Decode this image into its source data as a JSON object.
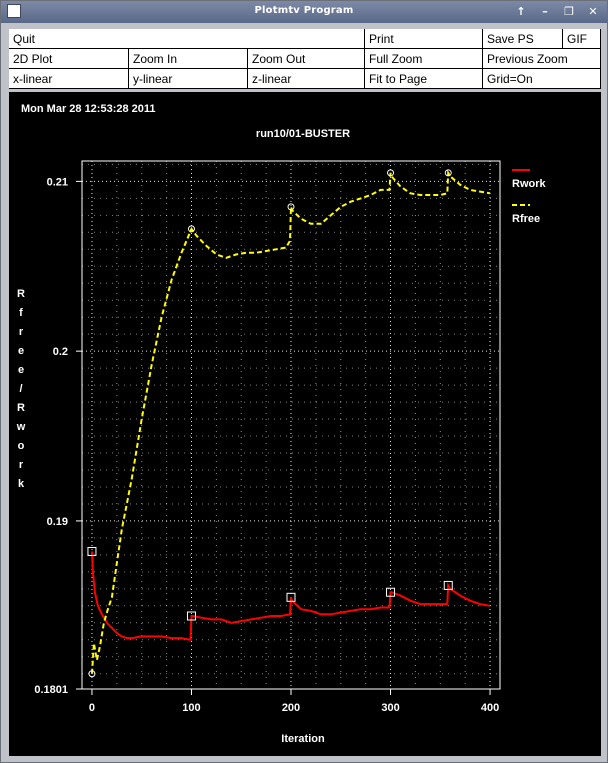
{
  "window": {
    "title": "Plotmtv Program",
    "buttons": [
      "↑",
      "–",
      "❐",
      "✕"
    ]
  },
  "menu": {
    "rows": [
      [
        "Quit",
        "Print",
        "Save PS",
        "GIF"
      ],
      [
        "2D Plot",
        "Zoom In",
        "Zoom Out",
        "Full Zoom",
        "Previous Zoom"
      ],
      [
        "x-linear",
        "y-linear",
        "z-linear",
        "Fit to Page",
        "Grid=On"
      ]
    ]
  },
  "plot": {
    "timestamp": "Mon Mar 28 12:53:28 2011"
  },
  "chart_data": {
    "type": "line",
    "title": "run10/01-BUSTER",
    "xlabel": "Iteration",
    "ylabel": "Rfree / Rwork",
    "xlim": [
      -10,
      410
    ],
    "ylim": [
      0.1801,
      0.2112
    ],
    "xticks": [
      0,
      100,
      200,
      300,
      400
    ],
    "yticks": [
      0.1801,
      0.19,
      0.2,
      0.21
    ],
    "ytick_labels": [
      "0.1801",
      "0.19",
      "0.2",
      "0.21"
    ],
    "grid": true,
    "legend_position": "right",
    "colors": {
      "Rwork": "#ff0000",
      "Rfree": "#ffff00",
      "axes": "#ffffff",
      "grid": "#ffffff"
    },
    "series": [
      {
        "name": "Rwork",
        "style": "solid",
        "marker": "square",
        "marker_x": [
          0,
          100,
          200,
          300,
          358
        ],
        "x": [
          0,
          1,
          3,
          6,
          10,
          15,
          20,
          25,
          30,
          35,
          40,
          50,
          60,
          70,
          80,
          90,
          99,
          100,
          101,
          110,
          120,
          130,
          140,
          150,
          160,
          170,
          180,
          190,
          199,
          200,
          201,
          210,
          220,
          230,
          240,
          250,
          260,
          270,
          280,
          290,
          299,
          300,
          301,
          310,
          320,
          330,
          340,
          350,
          357,
          358,
          360,
          370,
          380,
          390,
          400
        ],
        "values": [
          0.1882,
          0.187,
          0.1858,
          0.185,
          0.1845,
          0.184,
          0.1837,
          0.1834,
          0.1832,
          0.1831,
          0.1831,
          0.1832,
          0.1832,
          0.1832,
          0.1831,
          0.1831,
          0.183,
          0.1844,
          0.1844,
          0.1843,
          0.1842,
          0.1842,
          0.184,
          0.1841,
          0.1842,
          0.1843,
          0.1844,
          0.1844,
          0.1845,
          0.1855,
          0.1853,
          0.1848,
          0.1847,
          0.1845,
          0.1845,
          0.1846,
          0.1847,
          0.1848,
          0.1848,
          0.1849,
          0.1849,
          0.1858,
          0.1858,
          0.1856,
          0.1853,
          0.1851,
          0.1851,
          0.1851,
          0.1851,
          0.1862,
          0.186,
          0.1856,
          0.1853,
          0.1851,
          0.185
        ]
      },
      {
        "name": "Rfree",
        "style": "dashed",
        "marker": "circle",
        "marker_x": [
          0,
          100,
          200,
          300,
          358
        ],
        "x": [
          0,
          2,
          5,
          8,
          12,
          16,
          20,
          25,
          30,
          40,
          50,
          60,
          70,
          80,
          90,
          100,
          105,
          115,
          125,
          135,
          145,
          155,
          165,
          175,
          185,
          195,
          199,
          200,
          201,
          210,
          220,
          230,
          240,
          250,
          260,
          270,
          280,
          290,
          299,
          300,
          301,
          310,
          320,
          330,
          340,
          350,
          357,
          358,
          360,
          370,
          380,
          390,
          400
        ],
        "values": [
          0.181,
          0.1828,
          0.1818,
          0.1826,
          0.184,
          0.1848,
          0.1855,
          0.1875,
          0.1895,
          0.1925,
          0.196,
          0.1992,
          0.202,
          0.2042,
          0.2058,
          0.2072,
          0.2068,
          0.2062,
          0.2057,
          0.2055,
          0.2057,
          0.2058,
          0.2058,
          0.2059,
          0.206,
          0.2061,
          0.2065,
          0.2085,
          0.2083,
          0.2078,
          0.2075,
          0.2075,
          0.208,
          0.2085,
          0.2088,
          0.209,
          0.2092,
          0.2095,
          0.2095,
          0.2105,
          0.2103,
          0.2097,
          0.2093,
          0.2092,
          0.2092,
          0.2092,
          0.2093,
          0.2105,
          0.2103,
          0.2098,
          0.2095,
          0.2094,
          0.2093
        ]
      }
    ]
  }
}
